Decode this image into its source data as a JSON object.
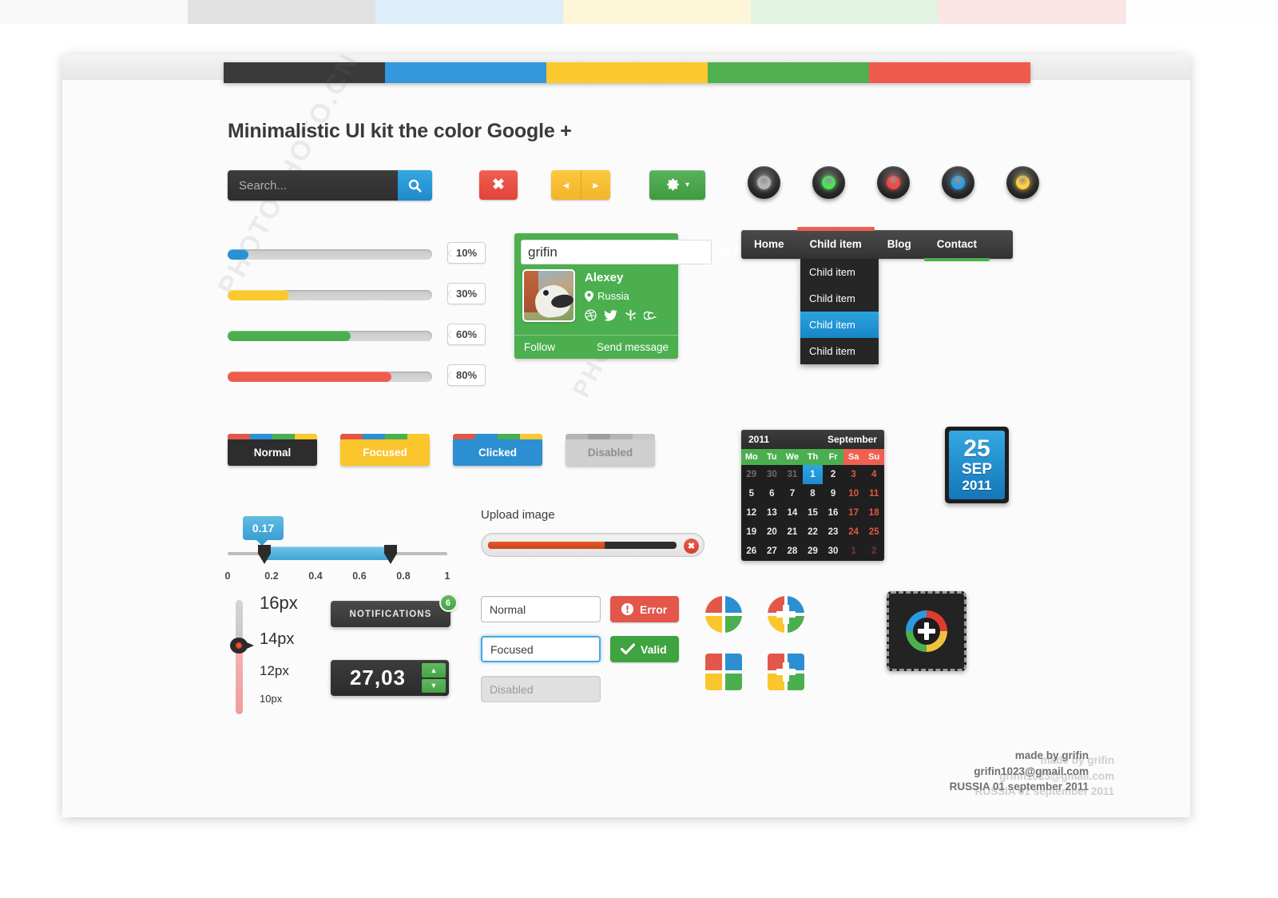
{
  "top_strip": {
    "segments": [
      "#f9f9f9",
      "#e2e2e2",
      "#dbeefa",
      "#fdf6d8",
      "#e2f3e2",
      "#fbe5e4",
      "#fdfdfd"
    ]
  },
  "sheet": {
    "color_bar": [
      "#3a3a3a",
      "#3398dc",
      "#fbc82e",
      "#50b04f",
      "#ef5b4c"
    ]
  },
  "title": "Minimalistic UI kit the color Google +",
  "search": {
    "placeholder": "Search...",
    "value": "",
    "icon": "search-icon",
    "button_color": "#2089cc"
  },
  "close_button": {
    "label": "✖",
    "color": "#e04437"
  },
  "arrows": {
    "prev": "◄",
    "next": "►",
    "color": "#f2b52a"
  },
  "gear_button": {
    "icon": "gear-icon",
    "caret": "▾",
    "color": "#3f9a40"
  },
  "leds": [
    {
      "name": "led-grey",
      "color": "#b4b4b4"
    },
    {
      "name": "led-green",
      "color": "#4ee05a"
    },
    {
      "name": "led-red",
      "color": "#f04a43"
    },
    {
      "name": "led-blue",
      "color": "#2f9ee0"
    },
    {
      "name": "led-yellow",
      "color": "#ffcf3d"
    }
  ],
  "progress_bars": [
    {
      "percent": 10,
      "label": "10%",
      "color": "#2d8fd4"
    },
    {
      "percent": 30,
      "label": "30%",
      "color": "#fbc82e"
    },
    {
      "percent": 60,
      "label": "60%",
      "color": "#4caf4f"
    },
    {
      "percent": 80,
      "label": "80%",
      "color": "#ef5b4c"
    }
  ],
  "profile": {
    "username": "grifin",
    "gear_icon": "gear-icon",
    "caret": "▾",
    "name": "Alexey",
    "location": "Russia",
    "location_icon": "map-pin-icon",
    "social": [
      "dribbble-icon",
      "twitter-icon",
      "forrst-icon",
      "lastfm-icon"
    ],
    "follow_label": "Follow",
    "message_label": "Send message",
    "bg_color": "#4caf4f"
  },
  "nav": {
    "items": [
      {
        "label": "Home",
        "accent": "none"
      },
      {
        "label": "Child item",
        "accent": "red-top"
      },
      {
        "label": "Blog",
        "accent": "none"
      },
      {
        "label": "Contact",
        "accent": "green-bottom"
      }
    ],
    "dropdown": [
      {
        "label": "Child item",
        "selected": false
      },
      {
        "label": "Child item",
        "selected": false
      },
      {
        "label": "Child item",
        "selected": true
      },
      {
        "label": "Child item",
        "selected": false
      }
    ]
  },
  "state_buttons": [
    {
      "label": "Normal",
      "bg": "#2d2d2d",
      "text": "#ffffff",
      "strip": [
        "#e2574a",
        "#2d8fd4",
        "#4caf4f",
        "#fbc82e"
      ]
    },
    {
      "label": "Focused",
      "bg": "#fbc52c",
      "text": "#ffffff",
      "strip": [
        "#e2574a",
        "#2d8fd4",
        "#4caf4f",
        "#fbc82e"
      ]
    },
    {
      "label": "Clicked",
      "bg": "#2b8fd2",
      "text": "#ffffff",
      "strip": [
        "#e2574a",
        "#2d8fd4",
        "#4caf4f",
        "#fbc82e"
      ]
    },
    {
      "label": "Disabled",
      "bg": "#cfcfcf",
      "text": "#8e8e8e",
      "strip": [
        "#b5b5b5",
        "#9e9e9e",
        "#b5b5b5",
        "#c8c8c8"
      ]
    }
  ],
  "range_slider": {
    "bubble_value": "0.17",
    "min": 0,
    "max": 1,
    "start": 0.17,
    "end": 0.8,
    "ticks": [
      "0",
      "0.2",
      "0.4",
      "0.6",
      "0.8",
      "1"
    ],
    "fill_color": "#3fa6d6"
  },
  "upload": {
    "label": "Upload image",
    "progress": 62,
    "fill_color": "#cf4518",
    "cancel_icon": "close-icon"
  },
  "calendar": {
    "year": "2011",
    "month": "September",
    "dow": [
      "Mo",
      "Tu",
      "We",
      "Th",
      "Fr",
      "Sa",
      "Su"
    ],
    "weeks": [
      [
        {
          "d": "29",
          "s": "mut"
        },
        {
          "d": "30",
          "s": "mut"
        },
        {
          "d": "31",
          "s": "mut"
        },
        {
          "d": "1",
          "s": "today"
        },
        {
          "d": "2",
          "s": ""
        },
        {
          "d": "3",
          "s": "we"
        },
        {
          "d": "4",
          "s": "we"
        }
      ],
      [
        {
          "d": "5",
          "s": ""
        },
        {
          "d": "6",
          "s": ""
        },
        {
          "d": "7",
          "s": ""
        },
        {
          "d": "8",
          "s": ""
        },
        {
          "d": "9",
          "s": ""
        },
        {
          "d": "10",
          "s": "we"
        },
        {
          "d": "11",
          "s": "we"
        }
      ],
      [
        {
          "d": "12",
          "s": ""
        },
        {
          "d": "13",
          "s": ""
        },
        {
          "d": "14",
          "s": ""
        },
        {
          "d": "15",
          "s": ""
        },
        {
          "d": "16",
          "s": ""
        },
        {
          "d": "17",
          "s": "we"
        },
        {
          "d": "18",
          "s": "we"
        }
      ],
      [
        {
          "d": "19",
          "s": ""
        },
        {
          "d": "20",
          "s": ""
        },
        {
          "d": "21",
          "s": ""
        },
        {
          "d": "22",
          "s": ""
        },
        {
          "d": "23",
          "s": ""
        },
        {
          "d": "24",
          "s": "we"
        },
        {
          "d": "25",
          "s": "we"
        }
      ],
      [
        {
          "d": "26",
          "s": ""
        },
        {
          "d": "27",
          "s": ""
        },
        {
          "d": "28",
          "s": ""
        },
        {
          "d": "29",
          "s": ""
        },
        {
          "d": "30",
          "s": ""
        },
        {
          "d": "1",
          "s": "wemut"
        },
        {
          "d": "2",
          "s": "wemut"
        }
      ]
    ]
  },
  "date_badge": {
    "day": "25",
    "month": "SEP",
    "year": "2011",
    "color": "#1f8ccd"
  },
  "font_slider": {
    "labels": [
      "16px",
      "14px",
      "12px",
      "10px"
    ],
    "selected": "14px",
    "track_active_color": "#ef9d9d"
  },
  "notifications": {
    "label": "NOTIFICATIONS",
    "count": "6",
    "badge_color": "#45a345"
  },
  "stepper": {
    "value": "27,03",
    "up": "▲",
    "down": "▼",
    "button_color": "#46a246"
  },
  "fields": [
    {
      "value": "Normal",
      "state": "normal",
      "tag": "Error",
      "tag_state": "err",
      "tag_icon": "alert-icon"
    },
    {
      "value": "Focused",
      "state": "focused",
      "tag": "Valid",
      "tag_state": "ok",
      "tag_icon": "check-icon"
    },
    {
      "value": "Disabled",
      "state": "disabled",
      "tag": "",
      "tag_state": "",
      "tag_icon": ""
    }
  ],
  "google_icons": {
    "colors": {
      "red": "#e2574a",
      "blue": "#2b8fd2",
      "yellow": "#fbc52c",
      "green": "#4caf4f"
    },
    "variants": [
      "circle-split-plus-icon",
      "circle-plus-icon",
      "square-split-plus-icon",
      "square-plus-icon"
    ]
  },
  "upload_box": {
    "icon": "rainbow-plus-icon"
  },
  "credits": {
    "line1": "made by grifin",
    "line2": "grifin1023@gmail.com",
    "line3": "RUSSIA 01 september 2011"
  }
}
